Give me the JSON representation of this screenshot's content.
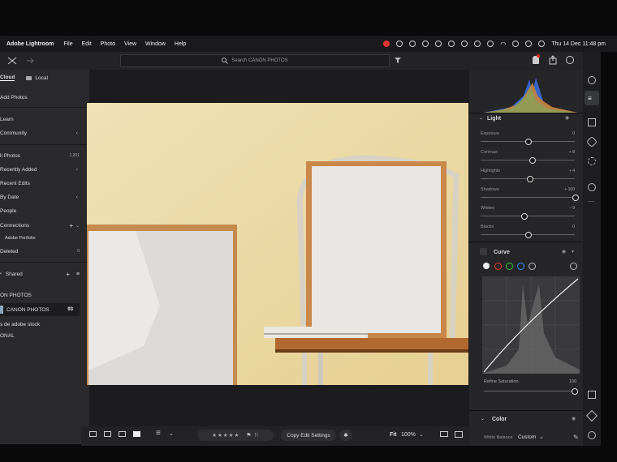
{
  "menubar": {
    "app_name": "Adobe Lightroom",
    "items": [
      "File",
      "Edit",
      "Photo",
      "View",
      "Window",
      "Help"
    ],
    "datetime": "Thu 14 Dec  11:48 pm"
  },
  "search": {
    "placeholder": "Search CANON PHOTOS"
  },
  "left_panel": {
    "tab_cloud": "Cloud",
    "tab_local": "Local",
    "add_photos": "Add Photos",
    "learn": "Learn",
    "community": "Community",
    "all_photos": "ll Photos",
    "all_photos_count": "1,201",
    "recently_added": "Recently Added",
    "recent_edits": "Recent Edits",
    "by_date": "By Date",
    "people": "People",
    "connections": "Connections",
    "adobe_portfolio": "Adobe Portfolio",
    "deleted": "Deleted",
    "deleted_count": "0",
    "shared": "Shared",
    "album_group": "ON PHOTOS",
    "album_selected": "CANON PHOTOS",
    "album_selected_count": "93",
    "album_other": "s de adobe stock",
    "album_other2": "ONAL"
  },
  "bottom_toolbar": {
    "copy_edit": "Copy Edit Settings",
    "fit": "Fit",
    "zoom": "100%",
    "stars": "★★★★★"
  },
  "edit_panel": {
    "light_title": "Light",
    "sliders": [
      {
        "label": "Exposure",
        "value": "0",
        "level": 0.5
      },
      {
        "label": "Contrast",
        "value": "+ 8",
        "level": 0.54
      },
      {
        "label": "Highlights",
        "value": "+ 4",
        "level": 0.52
      },
      {
        "label": "Shadows",
        "value": "+ 100",
        "level": 1.0
      },
      {
        "label": "Whites",
        "value": "− 9",
        "level": 0.46
      },
      {
        "label": "Blacks",
        "value": "0",
        "level": 0.5
      }
    ],
    "curve_title": "Curve",
    "refine_label": "Refine Saturation",
    "refine_value": "100",
    "refine_level": 1.0,
    "color_title": "Color",
    "white_balance_label": "White Balance",
    "white_balance_value": "Custom"
  },
  "colors": {
    "accent": "#4a8cff",
    "panel": "#262628"
  }
}
